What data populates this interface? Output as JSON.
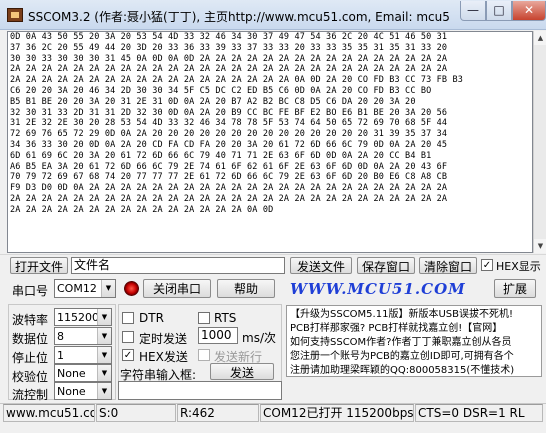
{
  "window": {
    "title": "SSCOM3.2 (作者:聂小猛(丁丁), 主页http://www.mcu51.com,  Email:  mcu5",
    "minimize": "—",
    "maximize": "□",
    "close": "✕"
  },
  "receive_area": {
    "lines": [
      "0D 0A 43 50 55 20 3A 20 53 54 4D 33 32 46 34 30 37 49 47 54 36 2C 20 4C 51 46 50 31",
      "37 36 2C 20 55 49 44 20 3D 20 33 36 33 39 33 37 33 33 20 33 33 35 35 31 35 31 33 20",
      "30 30 33 30 30 30 31 45 0A 0D 0A 0D 2A 2A 2A 2A 2A 2A 2A 2A 2A 2A 2A 2A 2A 2A 2A 2A",
      "2A 2A 2A 2A 2A 2A 2A 2A 2A 2A 2A 2A 2A 2A 2A 2A 2A 2A 2A 2A 2A 2A 2A 2A 2A 2A 2A 2A",
      "2A 2A 2A 2A 2A 2A 2A 2A 2A 2A 2A 2A 2A 2A 2A 2A 2A 2A 0A 0D 2A 20 CO FD B3 CC 73 FB B3",
      "C6 20 20 3A 20 46 34 2D 30 30 34 5F C5 DC C2 ED B5 C6 0D 0A 2A 20 CO FD B3 CC BO",
      "B5 B1 BE 20 20 3A 20 31 2E 31 0D 0A 2A 20 B7 A2 B2 BC C8 D5 C6 DA 20 20 3A 20",
      "32 30 31 33 2D 31 31 2D 32 30 0D 0A 2A 20 B9 CC BC FE BF E2 BO E6 B1 BE 20 3A 20 56",
      "31 2E 32 2E 30 20 28 53 54 4D 33 32 46 34 78 78 5F 53 74 64 50 65 72 69 70 68 5F 44",
      "72 69 76 65 72 29 0D 0A 2A 20 20 20 20 20 20 20 20 20 20 20 20 20 20 31 39 35 37 34",
      "34 36 33 30 20 0D 0A 2A 20 CD FA CD FA 20 20 3A 20 61 72 6D 66 6C 79 0D 0A 2A 20 45",
      "6D 61 69 6C 20 3A 20 61 72 6D 66 6C 79 40 71 71 2E 63 6F 6D 0D 0A 2A 20 CC B4 B1",
      "A6 B5 EA 3A 20 61 72 6D 66 6C 79 2E 74 61 6F 62 61 6F 2E 63 6F 6D 0D 0A 2A 20 43 6F",
      "70 79 72 69 67 68 74 20 77 77 77 2E 61 72 6D 66 6C 79 2E 63 6F 6D 20 B0 E6 C8 A8 CB",
      "F9 D3 D0 0D 0A 2A 2A 2A 2A 2A 2A 2A 2A 2A 2A 2A 2A 2A 2A 2A 2A 2A 2A 2A 2A 2A 2A 2A",
      "2A 2A 2A 2A 2A 2A 2A 2A 2A 2A 2A 2A 2A 2A 2A 2A 2A 2A 2A 2A 2A 2A 2A 2A 2A 2A 2A 2A",
      "2A 2A 2A 2A 2A 2A 2A 2A 2A 2A 2A 2A 2A 2A 2A 0A 0D"
    ]
  },
  "file_row": {
    "open_file": "打开文件",
    "filename_value": "文件名",
    "send_file": "发送文件",
    "save_window": "保存窗口",
    "clear_window": "清除窗口",
    "hex_display_label": "HEX显示",
    "hex_display_checked": true
  },
  "port_row": {
    "port_label": "串口号",
    "port_value": "COM12",
    "close_port": "关闭串口",
    "help": "帮助",
    "logo_text": "WWW.MCU51.COM",
    "expand": "扩展"
  },
  "settings": {
    "baud_label": "波特率",
    "baud_value": "115200",
    "databits_label": "数据位",
    "databits_value": "8",
    "stopbits_label": "停止位",
    "stopbits_value": "1",
    "parity_label": "校验位",
    "parity_value": "None",
    "flow_label": "流控制",
    "flow_value": "None"
  },
  "send_options": {
    "dtr_label": "DTR",
    "rts_label": "RTS",
    "timed_send_label": "定时发送",
    "interval_value": "1000",
    "interval_unit": "ms/次",
    "hex_send_label": "HEX发送",
    "hex_send_checked": true,
    "send_newline_label": "发送新行",
    "input_label": "字符串输入框:",
    "send_button": "发送"
  },
  "ad_lines": [
    "【升级为SSCOM5.11版】新版本USB误拔不死机!",
    "PCB打样那家强? PCB打样就找嘉立创!【官网】",
    "如何支持SSCOM作者?作者丁丁兼职嘉立创从各员",
    "您注册一个账号为PCB的嘉立创ID即可,可拥有各个",
    "注册请加助理梁晖颖的QQ:800058315(不懂技术)"
  ],
  "status": {
    "website": "www.mcu51.cor",
    "sent": "S:0",
    "received": "R:462",
    "port_state": "COM12已打开  115200bps",
    "signals": "CTS=0 DSR=1 RL"
  }
}
